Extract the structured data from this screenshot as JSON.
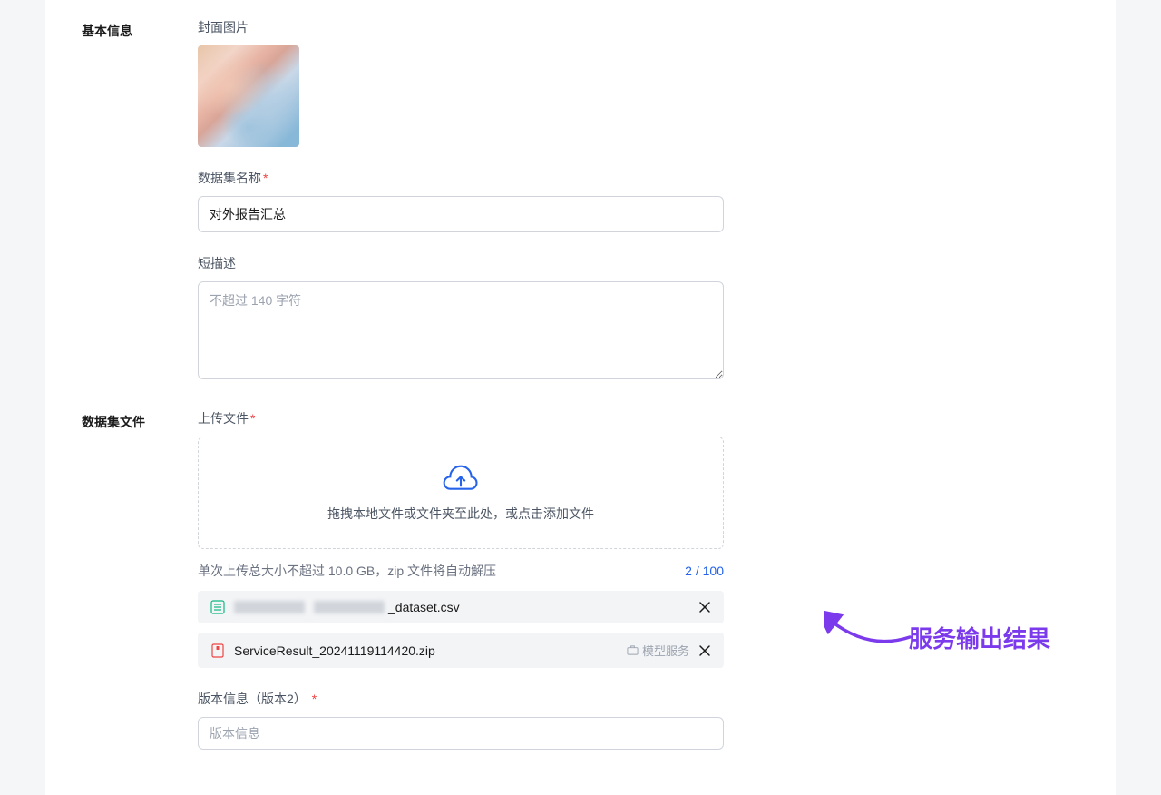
{
  "sections": {
    "basic": {
      "title": "基本信息",
      "fields": {
        "cover": {
          "label": "封面图片"
        },
        "name": {
          "label": "数据集名称",
          "value": "对外报告汇总"
        },
        "desc": {
          "label": "短描述",
          "placeholder": "不超过 140 字符"
        }
      }
    },
    "files": {
      "title": "数据集文件",
      "upload_label": "上传文件",
      "upload_text": "拖拽本地文件或文件夹至此处，或点击添加文件",
      "upload_hint": "单次上传总大小不超过 10.0 GB，zip 文件将自动解压",
      "upload_count": "2 / 100",
      "items": [
        {
          "name_suffix": "_dataset.csv",
          "type": "csv"
        },
        {
          "name": "ServiceResult_20241119114420.zip",
          "type": "zip",
          "tag": "模型服务"
        }
      ]
    },
    "version": {
      "label": "版本信息（版本2）",
      "placeholder": "版本信息"
    }
  },
  "annotation": {
    "text": "服务输出结果"
  }
}
